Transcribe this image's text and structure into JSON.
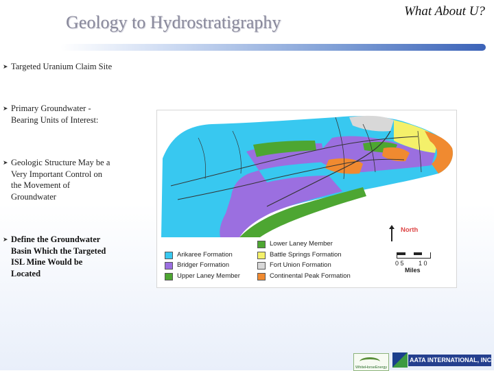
{
  "slide": {
    "title": "Geology to Hydrostratigraphy",
    "side_note": "What About U?",
    "bullets": [
      {
        "text": "Targeted Uranium Claim Site",
        "emphasis": false
      },
      {
        "text": "Primary Groundwater -Bearing Units of Interest:",
        "emphasis": false
      },
      {
        "text": "Geologic Structure May be a Very Important Control on the Movement of Groundwater",
        "emphasis": false
      },
      {
        "text": "Define the Groundwater Basin Which the Targeted ISL Mine Would be Located",
        "emphasis": true
      }
    ],
    "bullet_icon": "arrow-bullet-icon"
  },
  "map": {
    "legend": [
      {
        "label": "Arikaree Formation",
        "color": "#38c8f0"
      },
      {
        "label": "Bridger Formation",
        "color": "#9b6fe0"
      },
      {
        "label": "Upper Laney Member",
        "color": "#4da632"
      },
      {
        "label": "Lower Laney Member",
        "color": "#4da632"
      },
      {
        "label": "Battle Springs Formation",
        "color": "#f4f06a"
      },
      {
        "label": "Fort Union Formation",
        "color": "#d8d8d8"
      },
      {
        "label": "Continental Peak Formation",
        "color": "#f08a30"
      }
    ],
    "north_label": "North",
    "scale_left": "0 5",
    "scale_right": "1 0",
    "scale_unit": "Miles"
  },
  "logos": {
    "left_text": "WhiteHorseEnergy",
    "right_text": "AATA INTERNATIONAL, INC."
  }
}
